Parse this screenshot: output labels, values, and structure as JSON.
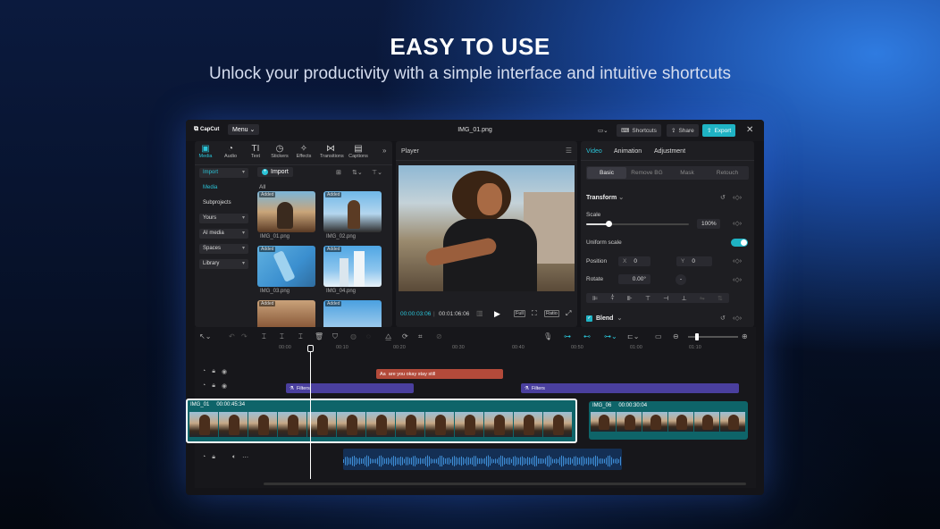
{
  "hero": {
    "title": "EASY TO USE",
    "subtitle": "Unlock your productivity with a simple interface and intuitive shortcuts"
  },
  "titlebar": {
    "logo_text": "CapCut",
    "menu_label": "Menu",
    "document_title": "IMG_01.png",
    "shortcuts_label": "Shortcuts",
    "share_label": "Share",
    "export_label": "Export"
  },
  "toolbar": {
    "tabs": [
      {
        "label": "Media",
        "icon": "media-icon"
      },
      {
        "label": "Audio",
        "icon": "audio-icon"
      },
      {
        "label": "Text",
        "icon": "text-icon"
      },
      {
        "label": "Stickers",
        "icon": "stickers-icon"
      },
      {
        "label": "Effects",
        "icon": "effects-icon"
      },
      {
        "label": "Transitions",
        "icon": "transitions-icon"
      },
      {
        "label": "Captions",
        "icon": "captions-icon"
      }
    ]
  },
  "sidebar": {
    "items": [
      "Import",
      "Media",
      "Subprojects",
      "Yours",
      "AI media",
      "Spaces",
      "Library"
    ]
  },
  "media": {
    "import_label": "Import",
    "filter_label": "All",
    "badge": "Added",
    "items": [
      {
        "name": "IMG_01.png"
      },
      {
        "name": "IMG_02.png"
      },
      {
        "name": "IMG_03.png"
      },
      {
        "name": "IMG_04.png"
      },
      {
        "name": ""
      },
      {
        "name": ""
      }
    ]
  },
  "player": {
    "title": "Player",
    "current_time": "00:00:03:06",
    "total_time": "00:01:06:06",
    "full_label": "Full",
    "ratio_label": "Ratio"
  },
  "inspector": {
    "tabs": [
      "Video",
      "Animation",
      "Adjustment"
    ],
    "subtabs": [
      "Basic",
      "Remove BG",
      "Mask",
      "Retouch"
    ],
    "transform_label": "Transform",
    "scale_label": "Scale",
    "scale_value": "100%",
    "scale_fraction": 0.22,
    "uniform_scale_label": "Uniform scale",
    "position_label": "Position",
    "pos_x_label": "X",
    "pos_x_value": "0",
    "pos_y_label": "Y",
    "pos_y_value": "0",
    "rotate_label": "Rotate",
    "rotate_value": "0.00°",
    "blend_label": "Blend"
  },
  "timeline": {
    "ticks": [
      "00:00",
      "00:10",
      "00:20",
      "00:30",
      "00:40",
      "00:50",
      "01:00",
      "01:10"
    ],
    "text_clip": "are you okay stay still",
    "filter_clip_1": "Filters",
    "filter_clip_2": "Filters",
    "main_clip_name": "IMG_01",
    "main_clip_duration": "00:00:45:34",
    "second_clip_name": "IMG_06",
    "second_clip_duration": "00:00:30:04"
  },
  "colors": {
    "accent": "#1fb3c4",
    "text_clip": "#b34a3a",
    "filter_clip": "#4a3f9e",
    "video_clip": "#0e6469"
  }
}
